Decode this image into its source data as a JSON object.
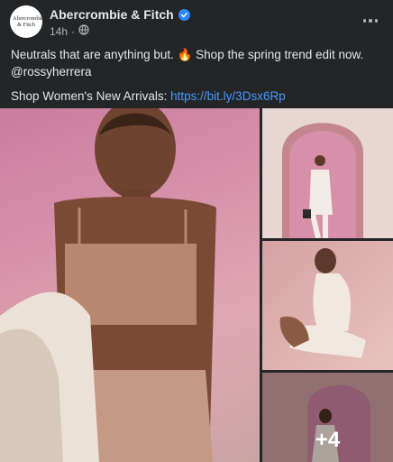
{
  "post": {
    "page_name": "Abercrombie & Fitch",
    "avatar_text": "Abercrombie & Fitch",
    "time": "14h",
    "caption_line1": "Neutrals that are anything but. 🔥  Shop the spring trend edit now. @rossyherrera",
    "shop_label": "Shop Women's New Arrivals: ",
    "shop_link": "https://bit.ly/3Dsx6Rp"
  },
  "gallery": {
    "more_count": "+4"
  },
  "colors": {
    "background": "#242526",
    "text": "#e4e6eb",
    "secondary_text": "#b0b3b8",
    "link": "#4599ff",
    "verified": "#2d88ff"
  },
  "icons": [
    "verified-badge-icon",
    "globe-icon",
    "more-options-icon"
  ]
}
